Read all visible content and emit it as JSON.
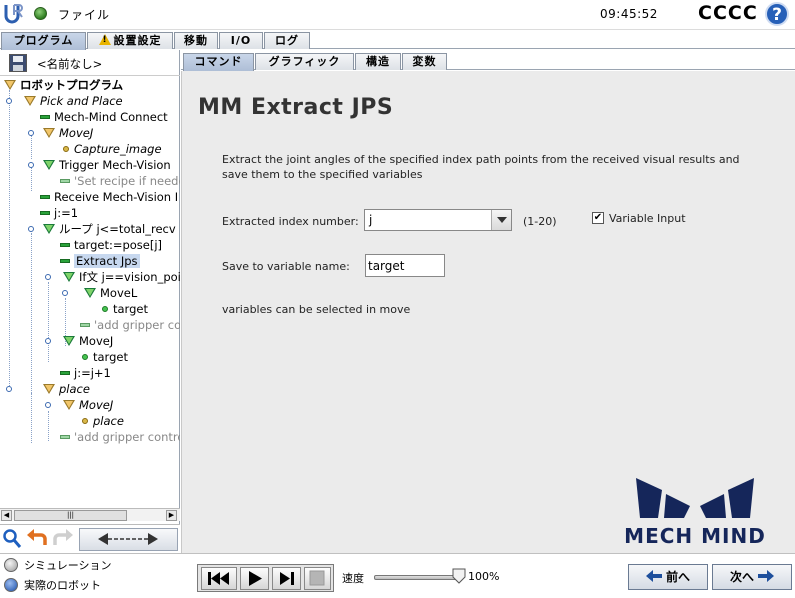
{
  "topbar": {
    "file_menu": "ファイル",
    "clock": "09:45:52",
    "robot_name": "CCCC",
    "help": "?"
  },
  "main_tabs": [
    "プログラム",
    "設置設定",
    "移動",
    "I/O",
    "ログ"
  ],
  "program_name": "<名前なし>",
  "tree": [
    {
      "label": "ロボットプログラム",
      "icon": "triangle"
    },
    {
      "label": "Pick and Place",
      "icon": "triangle"
    },
    {
      "label": "Mech-Mind Connect",
      "icon": "command"
    },
    {
      "label": "MoveJ",
      "icon": "triangle"
    },
    {
      "label": "Capture_image",
      "icon": "waypoint"
    },
    {
      "label": "Trigger Mech-Vision",
      "icon": "triangle"
    },
    {
      "label": "'Set recipe if neede",
      "icon": "command"
    },
    {
      "label": "Receive Mech-Vision I",
      "icon": "command"
    },
    {
      "label": "j:=1",
      "icon": "command"
    },
    {
      "label": "ループ j<=total_recv",
      "icon": "triangle"
    },
    {
      "label": "target:=pose[j]",
      "icon": "command"
    },
    {
      "label": "Extract Jps",
      "icon": "command"
    },
    {
      "label": "If文 j==vision_poi",
      "icon": "triangle"
    },
    {
      "label": "MoveL",
      "icon": "triangle"
    },
    {
      "label": "target",
      "icon": "waypoint"
    },
    {
      "label": "'add gripper co",
      "icon": "command"
    },
    {
      "label": "MoveJ",
      "icon": "triangle"
    },
    {
      "label": "target",
      "icon": "waypoint"
    },
    {
      "label": "j:=j+1",
      "icon": "command"
    },
    {
      "label": "place",
      "icon": "triangle"
    },
    {
      "label": "MoveJ",
      "icon": "triangle"
    },
    {
      "label": "place",
      "icon": "waypoint"
    },
    {
      "label": "'add gripper contro",
      "icon": "command"
    }
  ],
  "sub_tabs": [
    "コマンド",
    "グラフィック",
    "構造",
    "変数"
  ],
  "content": {
    "title": "MM Extract JPS",
    "description": "Extract the joint angles of the specified index path points from the received visual results and save them to the specified variables",
    "index_label": "Extracted index number:",
    "index_value": "j",
    "index_range": "(1-20)",
    "variable_input_label": "Variable Input",
    "variable_input_checked": "✔",
    "save_label": "Save to variable name:",
    "save_value": "target",
    "note": "variables can be selected in move",
    "brand": "MECH MIND"
  },
  "bottom": {
    "mode_simulation": "シミュレーション",
    "mode_real": "実際のロボット",
    "speed_label": "速度",
    "speed_value": "100%",
    "speed_fraction": 1.0,
    "prev_label": "前へ",
    "next_label": "次へ"
  },
  "colors": {
    "accent": "#2760b8",
    "brand": "#15265a",
    "content_bg": "#ebebeb",
    "tab_active": "#aebed6"
  }
}
